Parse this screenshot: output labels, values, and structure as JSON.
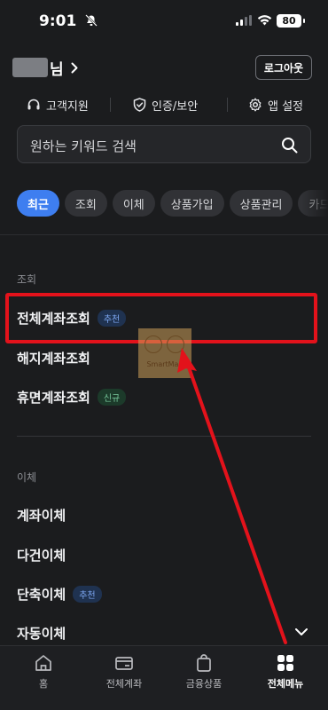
{
  "status_bar": {
    "time": "9:01",
    "battery": "80"
  },
  "header": {
    "name_suffix": "님",
    "logout_label": "로그아웃"
  },
  "quick_links": [
    {
      "label": "고객지원",
      "icon": "headset-icon"
    },
    {
      "label": "인증/보안",
      "icon": "shield-icon"
    },
    {
      "label": "앱 설정",
      "icon": "gear-icon"
    }
  ],
  "search": {
    "placeholder": "원하는 키워드 검색"
  },
  "chips": [
    "최근",
    "조회",
    "이체",
    "상품가입",
    "상품관리",
    "카드"
  ],
  "sections": [
    {
      "title": "조회",
      "items": [
        {
          "label": "전체계좌조회",
          "badge": "추천"
        },
        {
          "label": "해지계좌조회",
          "badge": ""
        },
        {
          "label": "휴면계좌조회",
          "badge": "신규"
        }
      ]
    },
    {
      "title": "이체",
      "items": [
        {
          "label": "계좌이체",
          "badge": ""
        },
        {
          "label": "다건이체",
          "badge": ""
        },
        {
          "label": "단축이체",
          "badge": "추천"
        },
        {
          "label": "자동이체",
          "badge": ""
        }
      ]
    }
  ],
  "watermark": {
    "text": "SmartMan"
  },
  "tabbar": [
    {
      "label": "홈",
      "icon": "home-icon"
    },
    {
      "label": "전체계좌",
      "icon": "account-card-icon"
    },
    {
      "label": "금융상품",
      "icon": "shopping-bag-icon"
    },
    {
      "label": "전체메뉴",
      "icon": "grid-menu-icon",
      "active": true
    }
  ],
  "colors": {
    "accent": "#3e7ef0",
    "annotation": "#e3121b",
    "background": "#1b1c1e"
  }
}
